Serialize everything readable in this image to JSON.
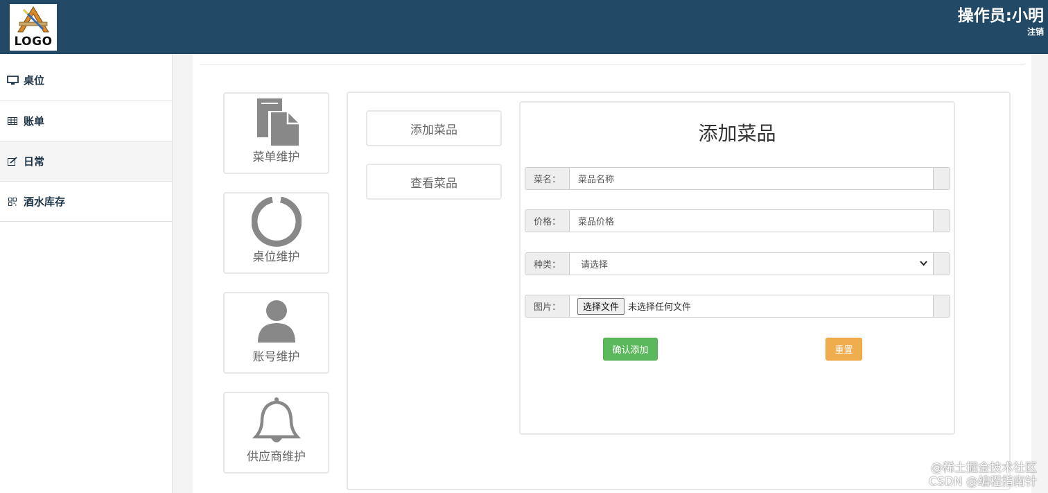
{
  "header": {
    "logo_text": "LOGO",
    "operator": "操作员:小明",
    "logout": "注销"
  },
  "sidebar": {
    "items": [
      {
        "label": "桌位",
        "icon": "monitor-icon"
      },
      {
        "label": "账单",
        "icon": "table-icon"
      },
      {
        "label": "日常",
        "icon": "edit-icon",
        "active": true
      },
      {
        "label": "酒水库存",
        "icon": "qrcode-icon"
      }
    ]
  },
  "tiles": [
    {
      "label": "菜单维护",
      "icon": "file-icon"
    },
    {
      "label": "桌位维护",
      "icon": "ring-icon"
    },
    {
      "label": "账号维护",
      "icon": "user-icon"
    },
    {
      "label": "供应商维护",
      "icon": "bell-icon"
    }
  ],
  "subnav": {
    "add_label": "添加菜品",
    "view_label": "查看菜品"
  },
  "form": {
    "title": "添加菜品",
    "name_label": "菜名：",
    "name_placeholder": "菜品名称",
    "price_label": "价格：",
    "price_placeholder": "菜品价格",
    "category_label": "种类：",
    "category_selected": "请选择",
    "image_label": "图片：",
    "file_button": "选择文件",
    "file_status": "未选择任何文件",
    "submit_label": "确认添加",
    "reset_label": "重置"
  },
  "watermark": {
    "line1": "@稀土掘金技术社区",
    "line2": "CSDN @编程指南针"
  },
  "colors": {
    "header_bg": "#224a67",
    "success": "#5cb85c",
    "warning": "#f0ad4e",
    "icon_gray": "#888888"
  }
}
